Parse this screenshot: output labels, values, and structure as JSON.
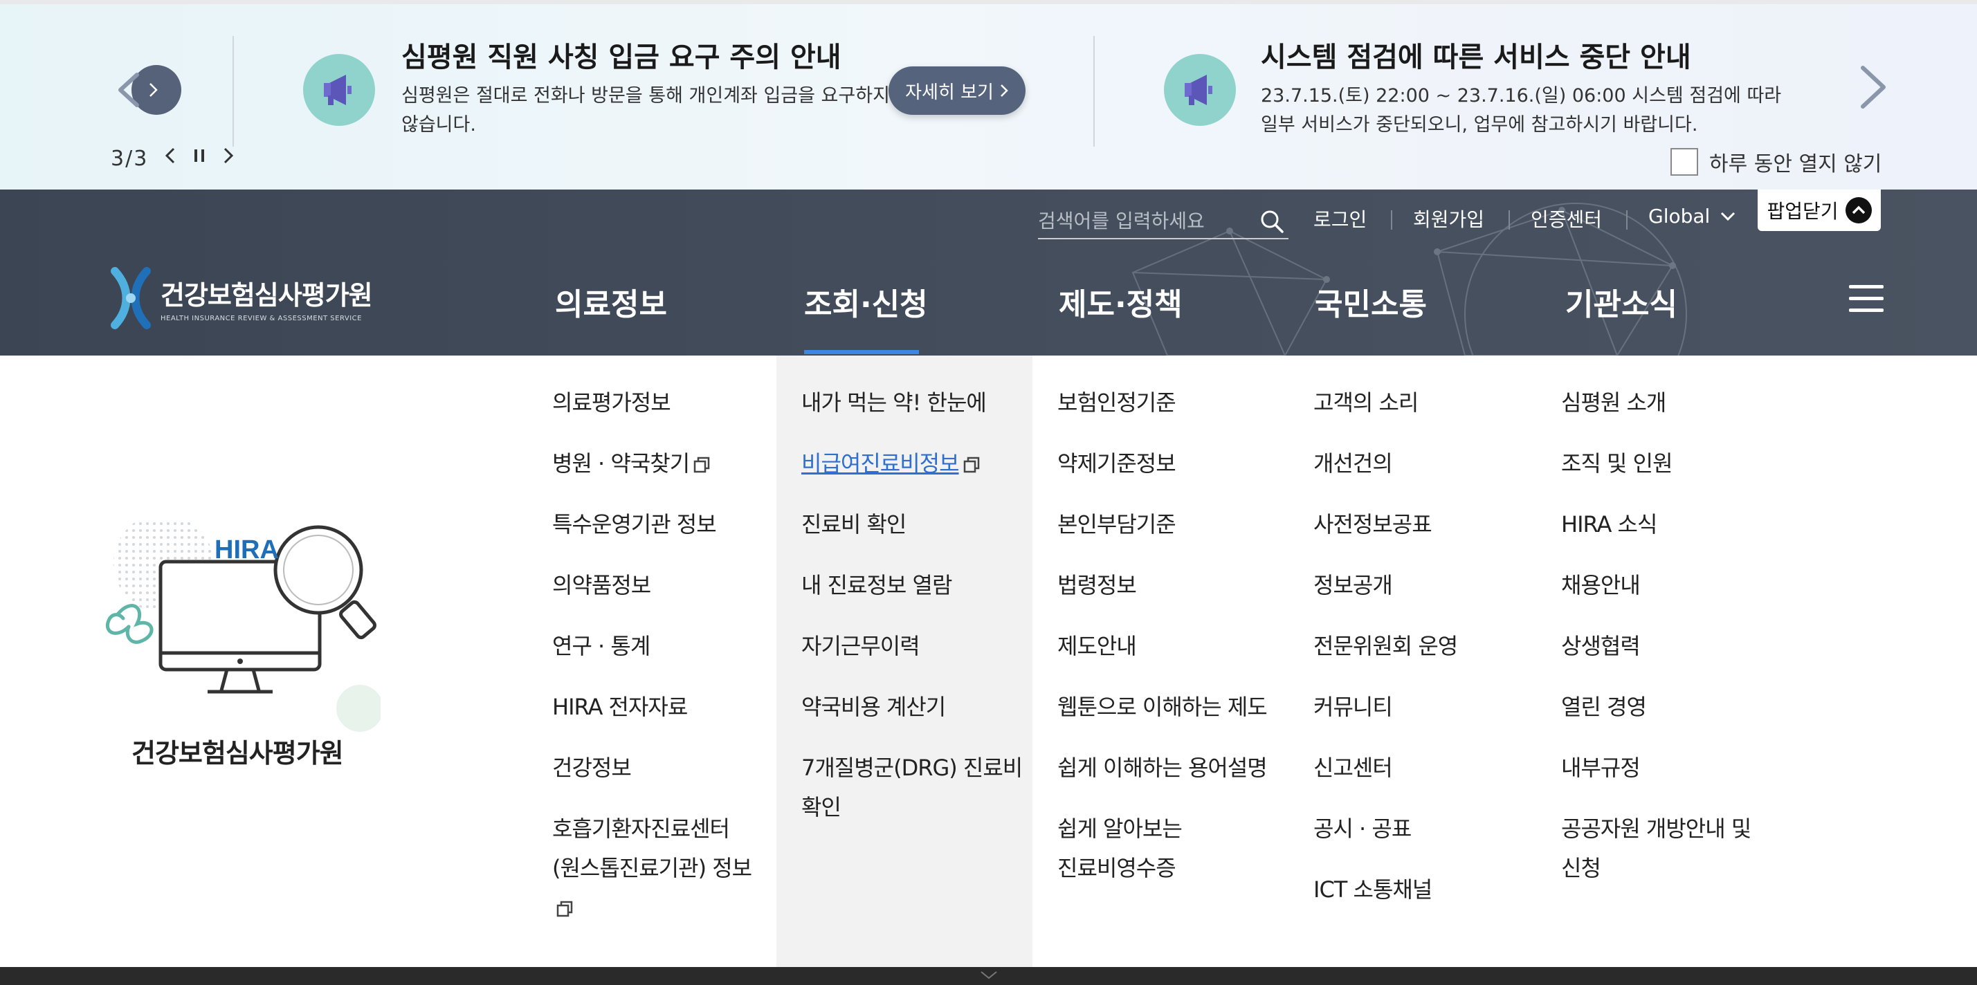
{
  "popup": {
    "pager_text": "3/3",
    "notices": [
      {
        "title": "심평원 직원 사칭 입금 요구 주의 안내",
        "body_line1": "심평원은 절대로 전화나 방문을 통해 개인계좌 입금을 요구하지",
        "body_line2": "않습니다.",
        "button_label": "자세히 보기"
      },
      {
        "title": "시스템 점검에 따른 서비스 중단 안내",
        "body_line1": "23.7.15.(토) 22:00 ~ 23.7.16.(일) 06:00 시스템 점검에 따라",
        "body_line2": "일부 서비스가 중단되오니, 업무에 참고하시기 바랍니다."
      }
    ],
    "no_show_today": "하루 동안 열지 않기",
    "icon": "megaphone-icon"
  },
  "header": {
    "search_placeholder": "검색어를 입력하세요",
    "util": {
      "login": "로그인",
      "signup": "회원가입",
      "cert": "인증센터",
      "global": "Global"
    },
    "popup_close": "팝업닫기",
    "logo_title": "건강보험심사평가원",
    "logo_sub": "HEALTH INSURANCE REVIEW & ASSESSMENT SERVICE",
    "nav": [
      "의료정보",
      "조회·신청",
      "제도·정책",
      "국민소통",
      "기관소식"
    ],
    "active_nav": "조회·신청"
  },
  "mega": {
    "illustration_label": "HIRA",
    "org_name": "건강보험심사평가원",
    "col1": {
      "i1": "의료평가정보",
      "i2": "병원 · 약국찾기",
      "i3": "특수운영기관 정보",
      "i4": "의약품정보",
      "i5": "연구 · 통계",
      "i6": "HIRA 전자자료",
      "i7": "건강정보",
      "i8a": "호흡기환자진료센터",
      "i8b": "(원스톱진료기관) 정보"
    },
    "col2": {
      "i1": "내가 먹는 약! 한눈에",
      "i2": "비급여진료비정보",
      "i3": "진료비 확인",
      "i4": "내 진료정보 열람",
      "i5": "자기근무이력",
      "i6": "약국비용 계산기",
      "i7a": "7개질병군(DRG) 진료비",
      "i7b": "확인"
    },
    "col3": {
      "i1": "보험인정기준",
      "i2": "약제기준정보",
      "i3": "본인부담기준",
      "i4": "법령정보",
      "i5": "제도안내",
      "i6": "웹툰으로 이해하는 제도",
      "i7": "쉽게 이해하는 용어설명",
      "i8a": "쉽게 알아보는",
      "i8b": "진료비영수증"
    },
    "col4": {
      "i1": "고객의 소리",
      "i2": "개선건의",
      "i3": "사전정보공표",
      "i4": "정보공개",
      "i5": "전문위원회 운영",
      "i6": "커뮤니티",
      "i7": "신고센터",
      "i8": "공시 · 공표",
      "i9": "ICT 소통채널"
    },
    "col5": {
      "i1": "심평원 소개",
      "i2": "조직 및 인원",
      "i3": "HIRA 소식",
      "i4": "채용안내",
      "i5": "상생협력",
      "i6": "열린 경영",
      "i7": "내부규정",
      "i8a": "공공자원 개방안내 및",
      "i8b": "신청"
    }
  },
  "colors": {
    "header_bg": "#434d5b",
    "accent_blue": "#3e86e0",
    "button_bg": "#55637c",
    "link_blue": "#2e6fd1",
    "icon_teal": "#8fd3cc"
  }
}
